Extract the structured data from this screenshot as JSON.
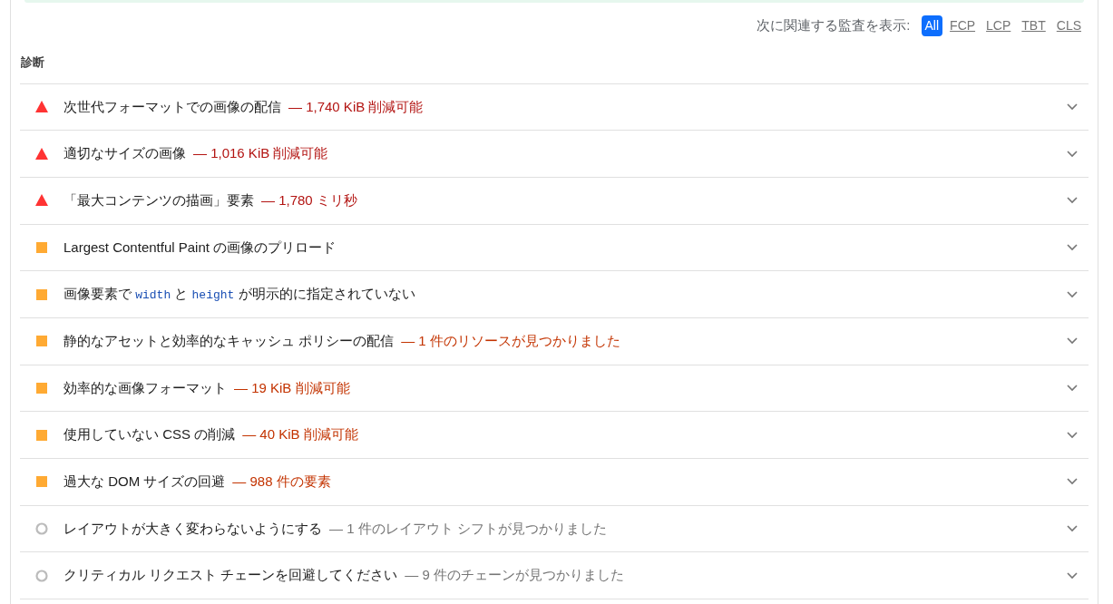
{
  "filter": {
    "label": "次に関連する監査を表示:",
    "options": [
      {
        "label": "All",
        "selected": true
      },
      {
        "label": "FCP",
        "selected": false
      },
      {
        "label": "LCP",
        "selected": false
      },
      {
        "label": "TBT",
        "selected": false
      },
      {
        "label": "CLS",
        "selected": false
      }
    ]
  },
  "section": {
    "title": "診断"
  },
  "audits": [
    {
      "kind": "fail",
      "title": [
        {
          "kind": "text",
          "text": "次世代フォーマットでの画像の配信"
        }
      ],
      "display": "— 1,740 KiB 削減可能",
      "expanded": false
    },
    {
      "kind": "fail",
      "title": [
        {
          "kind": "text",
          "text": "適切なサイズの画像"
        }
      ],
      "display": "— 1,016 KiB 削減可能",
      "expanded": false
    },
    {
      "kind": "fail",
      "title": [
        {
          "kind": "text",
          "text": "「最大コンテンツの描画」要素"
        }
      ],
      "display": "— 1,780 ミリ秒",
      "expanded": false
    },
    {
      "kind": "average",
      "title": [
        {
          "kind": "text",
          "text": "Largest Contentful Paint の画像のプリロード"
        }
      ],
      "expanded": false
    },
    {
      "kind": "average",
      "title": [
        {
          "kind": "text",
          "text": "画像要素で"
        },
        {
          "kind": "code",
          "text": "width"
        },
        {
          "kind": "text",
          "text": "と"
        },
        {
          "kind": "code",
          "text": "height"
        },
        {
          "kind": "text",
          "text": "が明示的に指定されていない"
        }
      ],
      "expanded": false
    },
    {
      "kind": "average",
      "title": [
        {
          "kind": "text",
          "text": "静的なアセットと効率的なキャッシュ ポリシーの配信"
        }
      ],
      "display": "— 1 件のリソースが見つかりました",
      "expanded": false
    },
    {
      "kind": "average",
      "title": [
        {
          "kind": "text",
          "text": "効率的な画像フォーマット"
        }
      ],
      "display": "— 19 KiB 削減可能",
      "expanded": false
    },
    {
      "kind": "average",
      "title": [
        {
          "kind": "text",
          "text": "使用していない CSS の削減"
        }
      ],
      "display": "— 40 KiB 削減可能",
      "expanded": false
    },
    {
      "kind": "average",
      "title": [
        {
          "kind": "text",
          "text": "過大な DOM サイズの回避"
        }
      ],
      "display": "— 988 件の要素",
      "expanded": false
    },
    {
      "kind": "informative",
      "title": [
        {
          "kind": "text",
          "text": "レイアウトが大きく変わらないようにする"
        }
      ],
      "display": "— 1 件のレイアウト シフトが見つかりました",
      "expanded": false
    },
    {
      "kind": "informative",
      "title": [
        {
          "kind": "text",
          "text": "クリティカル リクエスト チェーンを回避してください"
        }
      ],
      "display": "— 9 件のチェーンが見つかりました",
      "expanded": false
    }
  ]
}
